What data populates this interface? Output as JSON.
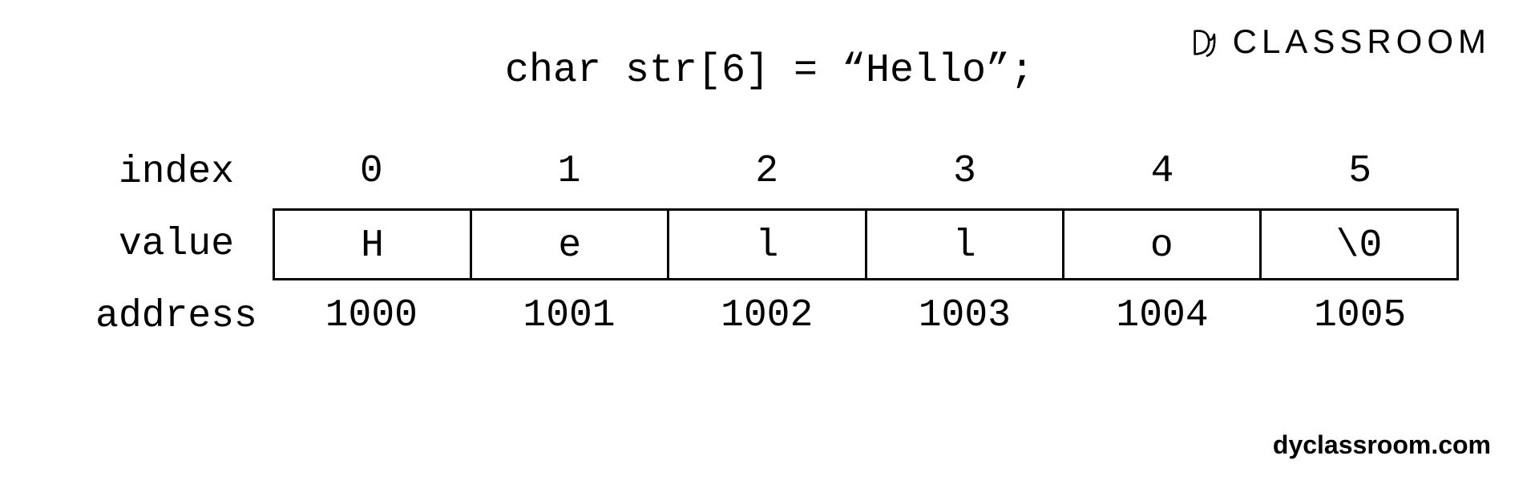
{
  "brand": {
    "text": "CLASSROOM"
  },
  "declaration": "char str[6] = “Hello”;",
  "labels": {
    "index": "index",
    "value": "value",
    "address": "address"
  },
  "cells": {
    "index": [
      "0",
      "1",
      "2",
      "3",
      "4",
      "5"
    ],
    "value": [
      "H",
      "e",
      "l",
      "l",
      "o",
      "\\0"
    ],
    "address": [
      "1000",
      "1001",
      "1002",
      "1003",
      "1004",
      "1005"
    ]
  },
  "footer": "dyclassroom.com",
  "chart_data": {
    "type": "table",
    "title": "char str[6] = \"Hello\";",
    "columns": [
      "index",
      "value",
      "address"
    ],
    "rows": [
      {
        "index": 0,
        "value": "H",
        "address": 1000
      },
      {
        "index": 1,
        "value": "e",
        "address": 1001
      },
      {
        "index": 2,
        "value": "l",
        "address": 1002
      },
      {
        "index": 3,
        "value": "l",
        "address": 1003
      },
      {
        "index": 4,
        "value": "o",
        "address": 1004
      },
      {
        "index": 5,
        "value": "\\0",
        "address": 1005
      }
    ]
  }
}
